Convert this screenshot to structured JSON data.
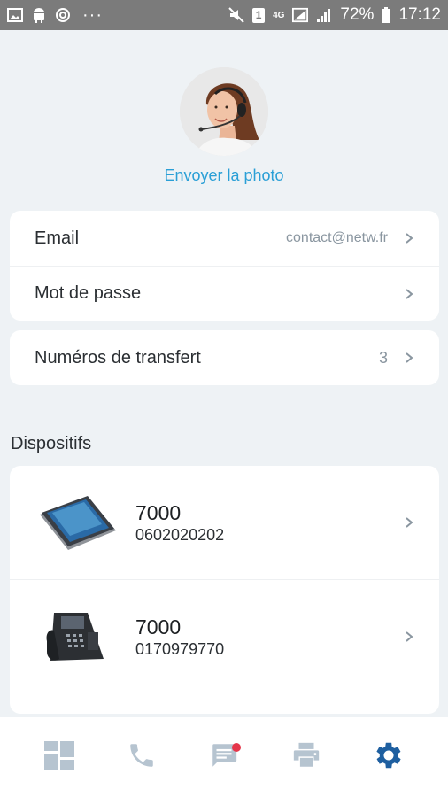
{
  "status_bar": {
    "battery": "72%",
    "time": "17:12",
    "network": "4G",
    "sim": "1",
    "more": "···"
  },
  "profile": {
    "send_photo_label": "Envoyer la photo"
  },
  "account": {
    "email_label": "Email",
    "email_value": "contact@netw.fr",
    "password_label": "Mot de passe"
  },
  "transfer": {
    "label": "Numéros de transfert",
    "count": "3"
  },
  "devices": {
    "title": "Dispositifs",
    "items": [
      {
        "extension": "7000",
        "number": "0602020202",
        "icon": "smartphone-icon"
      },
      {
        "extension": "7000",
        "number": "0170979770",
        "icon": "desk-phone-icon"
      }
    ]
  },
  "bottom_nav": {
    "items": [
      "dashboard-icon",
      "phone-icon",
      "message-icon",
      "fax-icon",
      "settings-icon"
    ],
    "active": "settings-icon",
    "colors": {
      "inactive": "#b6c4d0",
      "active": "#1e5fa0",
      "badge": "#e5364a"
    }
  },
  "colors": {
    "accent_link": "#2a9fd6",
    "background": "#eef2f5",
    "status_bar": "#7b7b7b"
  }
}
